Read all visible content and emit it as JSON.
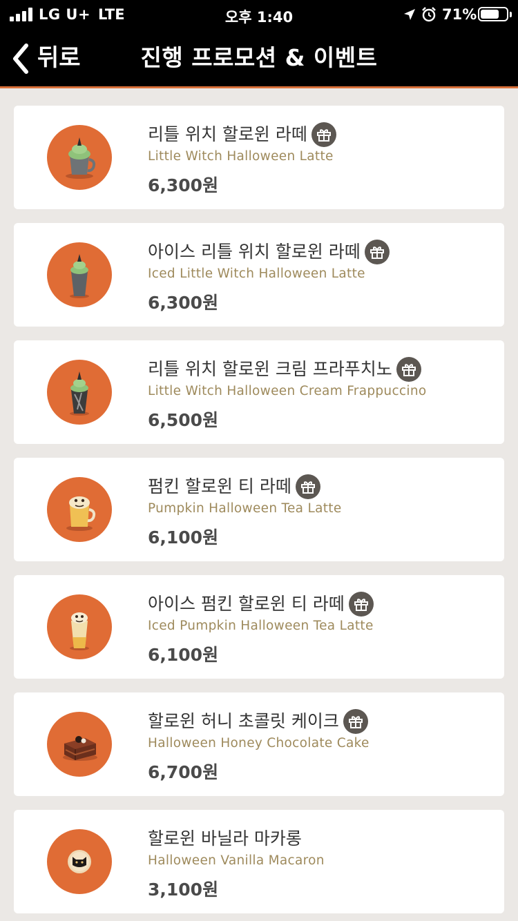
{
  "status_bar": {
    "carrier": "LG U+",
    "network": "LTE",
    "time": "오후 1:40",
    "battery": "71%",
    "battery_level": 0.71
  },
  "nav": {
    "back_label": "뒤로",
    "title": "진행 프로모션 & 이벤트"
  },
  "colors": {
    "accent": "#e06c35",
    "header_bg": "#000000",
    "english_text": "#9e8a5c",
    "background": "#ebe8e5"
  },
  "items": [
    {
      "name": "리틀 위치 할로윈 라떼",
      "english": "Little Witch Halloween Latte",
      "price": "6,300원",
      "gift": true
    },
    {
      "name": "아이스 리틀 위치 할로윈 라떼",
      "english": "Iced Little Witch Halloween Latte",
      "price": "6,300원",
      "gift": true
    },
    {
      "name": "리틀 위치 할로윈 크림 프라푸치노",
      "english": "Little Witch Halloween Cream Frappuccino",
      "price": "6,500원",
      "gift": true
    },
    {
      "name": "펌킨 할로윈 티 라떼",
      "english": "Pumpkin Halloween Tea Latte",
      "price": "6,100원",
      "gift": true
    },
    {
      "name": "아이스 펌킨 할로윈 티 라떼",
      "english": "Iced Pumpkin Halloween Tea Latte",
      "price": "6,100원",
      "gift": true
    },
    {
      "name": "할로윈 허니 초콜릿 케이크",
      "english": "Halloween Honey Chocolate Cake",
      "price": "6,700원",
      "gift": true
    },
    {
      "name": "할로윈 바닐라 마카롱",
      "english": "Halloween Vanilla Macaron",
      "price": "3,100원",
      "gift": false
    }
  ]
}
